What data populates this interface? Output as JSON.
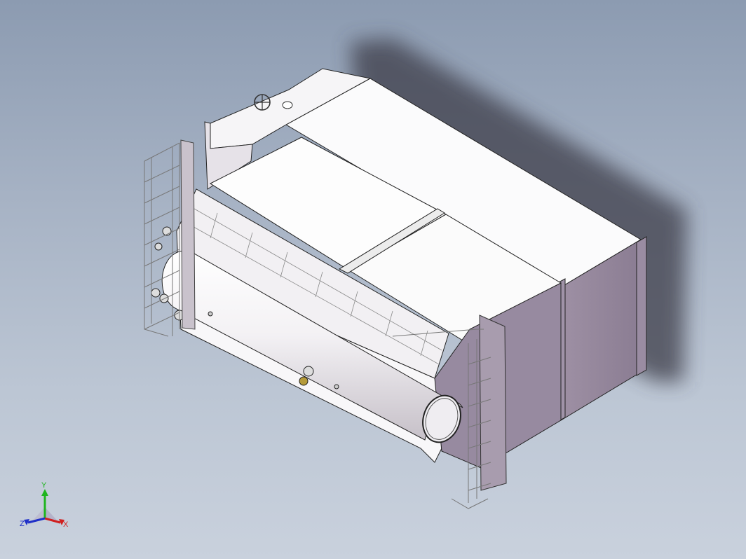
{
  "viewport": {
    "background_top": "#8c9bb1",
    "background_bottom": "#c9d1dd"
  },
  "model": {
    "icon": "boiler-assembly-model"
  },
  "triad": {
    "x_label": "X",
    "y_label": "Y",
    "z_label": "Z",
    "x_color": "#d02020",
    "y_color": "#1fb51f",
    "z_color": "#2030c8"
  }
}
